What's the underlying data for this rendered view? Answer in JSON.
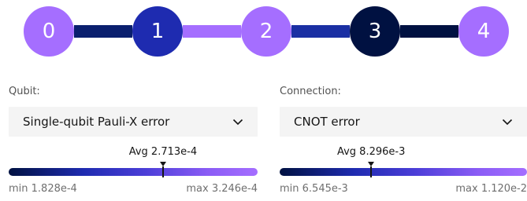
{
  "topology": {
    "nodes": [
      {
        "label": "0",
        "color": "#a56eff"
      },
      {
        "label": "1",
        "color": "#1e2bb0"
      },
      {
        "label": "2",
        "color": "#a56eff"
      },
      {
        "label": "3",
        "color": "#001141"
      },
      {
        "label": "4",
        "color": "#a56eff"
      }
    ],
    "edges": [
      {
        "from": "0",
        "to": "1",
        "color": "#0a1f6e"
      },
      {
        "from": "1",
        "to": "2",
        "color": "#a56eff"
      },
      {
        "from": "2",
        "to": "3",
        "color": "#1a2fa3"
      },
      {
        "from": "3",
        "to": "4",
        "color": "#001141"
      }
    ]
  },
  "qubit_panel": {
    "label": "Qubit:",
    "selected": "Single-qubit Pauli-X error",
    "chevron_icon": "chevron-down-icon",
    "avg_text": "Avg 2.713e-4",
    "avg_fraction": 0.62,
    "min_text": "min 1.828e-4",
    "max_text": "max 3.246e-4"
  },
  "connection_panel": {
    "label": "Connection:",
    "selected": "CNOT error",
    "chevron_icon": "chevron-down-icon",
    "avg_text": "Avg 8.296e-3",
    "avg_fraction": 0.37,
    "min_text": "min 6.545e-3",
    "max_text": "max 1.120e-2"
  },
  "colors": {
    "gradient_start": "#001141",
    "gradient_end": "#a56eff"
  }
}
